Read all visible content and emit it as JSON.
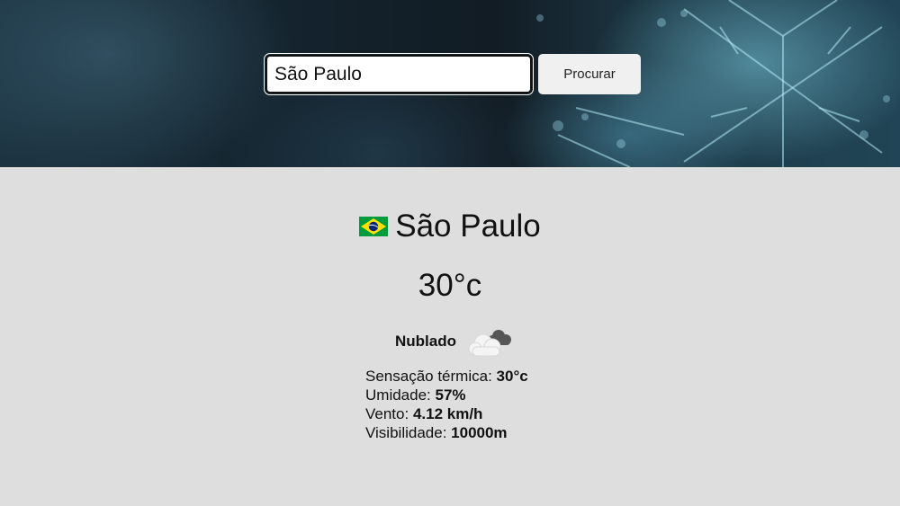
{
  "search": {
    "value": "São Paulo",
    "button_label": "Procurar"
  },
  "weather": {
    "city": "São Paulo",
    "country_flag": "brazil-flag-icon",
    "temperature": "30°c",
    "condition": "Nublado",
    "condition_icon": "cloudy-icon",
    "details": {
      "feels_like_label": "Sensação térmica:",
      "feels_like_value": "30°c",
      "humidity_label": "Umidade:",
      "humidity_value": "57%",
      "wind_label": "Vento:",
      "wind_value": "4.12 km/h",
      "visibility_label": "Visibilidade:",
      "visibility_value": "10000m"
    }
  },
  "colors": {
    "page_background": "#dedede",
    "button_background": "#f0f0f0",
    "text": "#111111"
  }
}
